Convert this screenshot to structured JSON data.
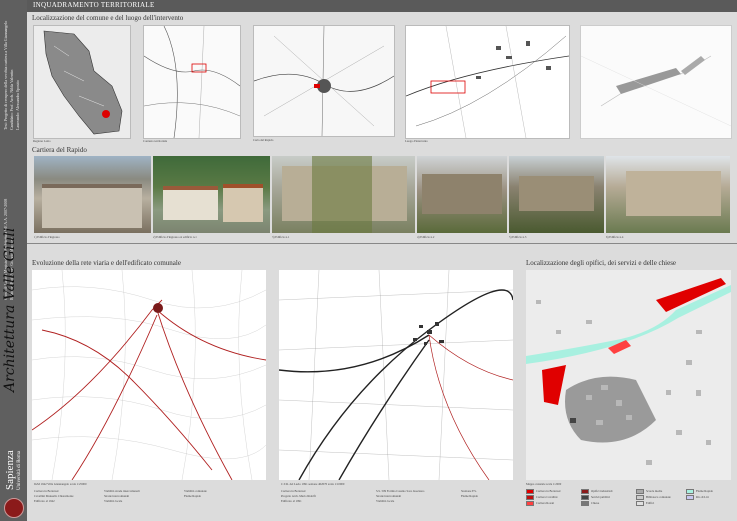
{
  "header": {
    "title": "INQUADRAMENTO TERRITORIALE"
  },
  "sidebar": {
    "top_lines": [
      "Tesi: Progetto di recupero della vecchia cartiera a Villa Giannangelo",
      "Candidato: Prof. Arch. Nilda Valentin",
      "Laureando: Alessandra Sposito"
    ],
    "bottom_lines": [
      "Corso di Laurea Magistrale in Architettura UE A.A. 2007-2008",
      "Relatore: Prof. Arch. Giorgio Muratore"
    ],
    "university": "Sapienza",
    "university_sub": "Università di Roma"
  },
  "section1": {
    "title": "Localizzazione del comune e del luogo dell'intervento",
    "captions": [
      "Regione Lazio",
      "Contesto territoriale",
      "Carta del Rapido",
      "Luogo d'intervento",
      ""
    ]
  },
  "section2": {
    "title": "Cartiera del Rapido",
    "captions": [
      "1) Edificio d'ingresso",
      "2) Edificio d'ingresso ex edificio n.1",
      "3) Edificio n.1",
      "4) Edificio n.2",
      "5) Edificio n.3",
      "6) Edificio n.4"
    ]
  },
  "section3": {
    "title": "Evoluzione della rete viaria e dell'edificato comunale",
    "map1_caption": "IGM 1942 Villa Giannangelo scala 1:25000",
    "map1_legend": [
      "Cartiera in Botteraal",
      "Cavallini Manuello Chiaramonte",
      "Edificato al 1942",
      "Viabilità strade intercomunali",
      "Strade intercomunali",
      "Viabilità locale",
      "Viabilità comunale",
      "Fiume Rapido"
    ],
    "map2_caption": "C.T.R. del Lazio 1991 sezione 402070 scala 1:10000",
    "map2_legend": [
      "Cartiera in Botteraal",
      "Progetto Arch. Mario Ridolfi",
      "Edificato al 1991",
      "S.S. 509 Formia Cassino Sora Avezzano",
      "Strade intercomunali",
      "Viabilità locale",
      "Stazione F.S.",
      "Fiume Rapido"
    ]
  },
  "section4": {
    "title": "Localizzazione degli opifici, dei servizi e delle chiese",
    "caption": "Mappa catastale scala 1:2000",
    "legend": [
      {
        "label": "Cartiera in Botteraal",
        "color": "#e00000"
      },
      {
        "label": "Cartiera Cavallini",
        "color": "#c01010"
      },
      {
        "label": "Cartiera Rosati",
        "color": "#ff4040"
      },
      {
        "label": "Opifici industriali",
        "color": "#8a1a1a"
      },
      {
        "label": "Servizi pubblici",
        "color": "#444444"
      },
      {
        "label": "Chiese",
        "color": "#777777"
      },
      {
        "label": "Scuole medie",
        "color": "#aaaaaa"
      },
      {
        "label": "Biblioteca comunale",
        "color": "#cccccc"
      },
      {
        "label": "Edifici",
        "color": "#e0e0e0"
      },
      {
        "label": "Fiume Rapido",
        "color": "#a8f0e0"
      },
      {
        "label": "Rio di Liri",
        "color": "#c8c8f0"
      }
    ]
  },
  "colors": {
    "accent": "#e00000",
    "river": "#a8f0e0",
    "header": "#5a5a5a"
  }
}
